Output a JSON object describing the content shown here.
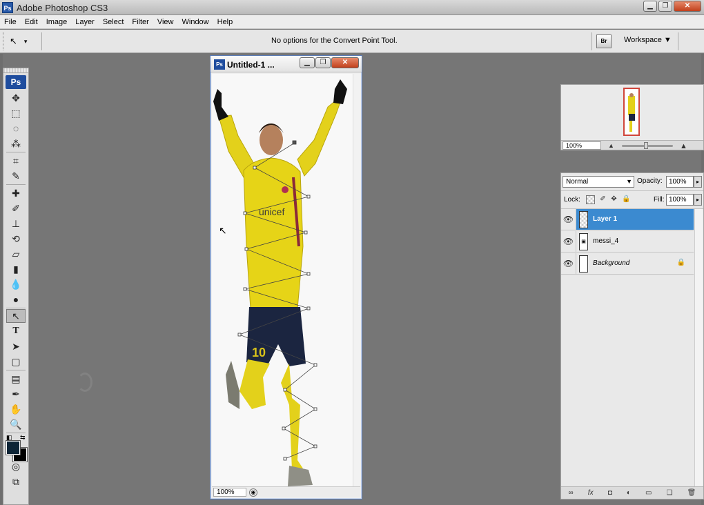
{
  "window": {
    "title": "Adobe Photoshop CS3",
    "app_icon": "Ps"
  },
  "menu": [
    "File",
    "Edit",
    "Image",
    "Layer",
    "Select",
    "Filter",
    "View",
    "Window",
    "Help"
  ],
  "options_bar": {
    "tool_icon": "convert-point-tool-icon",
    "message": "No options for the Convert Point Tool.",
    "bridge_label": "Br",
    "workspace_label": "Workspace"
  },
  "toolbox": {
    "logo": "Ps",
    "tools": [
      "move-tool-icon",
      "marquee-tool-icon",
      "lasso-tool-icon",
      "magic-wand-tool-icon",
      "crop-tool-icon",
      "slice-tool-icon",
      "healing-brush-tool-icon",
      "brush-tool-icon",
      "clone-stamp-tool-icon",
      "history-brush-tool-icon",
      "eraser-tool-icon",
      "gradient-tool-icon",
      "blur-tool-icon",
      "dodge-tool-icon",
      "convert-point-tool-icon",
      "type-tool-icon",
      "path-selection-tool-icon",
      "rectangle-tool-icon",
      "notes-tool-icon",
      "eyedropper-tool-icon",
      "hand-tool-icon",
      "zoom-tool-icon"
    ],
    "active_tool": "convert-point-tool-icon",
    "foreground_color": "#0d2436",
    "background_color": "#000000"
  },
  "document": {
    "title": "Untitled-1 ...",
    "zoom": "100%"
  },
  "navigator": {
    "zoom": "100%"
  },
  "layers_panel": {
    "blend_mode": "Normal",
    "opacity_label": "Opacity:",
    "opacity_value": "100%",
    "lock_label": "Lock:",
    "fill_label": "Fill:",
    "fill_value": "100%",
    "layers": [
      {
        "name": "Layer 1",
        "selected": true
      },
      {
        "name": "messi_4",
        "selected": false
      },
      {
        "name": "Background",
        "selected": false
      }
    ]
  },
  "colors": {
    "selection_blue": "#3b8ad0",
    "jersey_yellow": "#e9d514",
    "shorts_navy": "#1b2540"
  }
}
